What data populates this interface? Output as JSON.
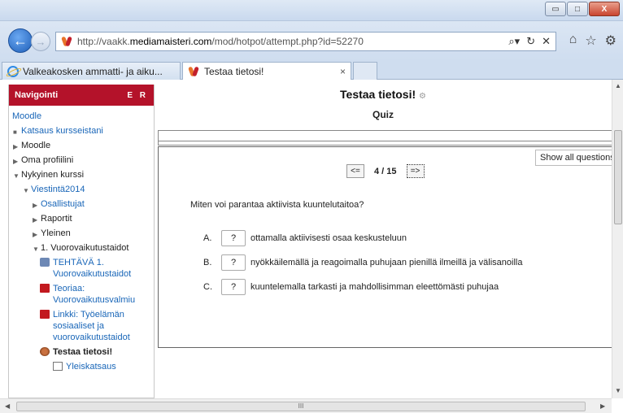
{
  "browser": {
    "url_prefix": "http://vaakk.",
    "url_domain": "mediamaisteri.com",
    "url_path": "/mod/hotpot/attempt.php?id=52270",
    "tabs": [
      {
        "label": "Valkeakosken ammatti- ja aiku..."
      },
      {
        "label": "Testaa tietosi!",
        "close": "×"
      }
    ],
    "window_controls": {
      "minimize": "▭",
      "maximize": "□",
      "close": "X"
    }
  },
  "sidebar": {
    "header": "Navigointi",
    "header_controls": "E R",
    "items": [
      {
        "label": "Moodle"
      },
      {
        "label": "Katsaus kursseistani"
      },
      {
        "label": "Moodle"
      },
      {
        "label": "Oma profiilini"
      },
      {
        "label": "Nykyinen kurssi"
      },
      {
        "label": "Viestintä2014"
      },
      {
        "label": "Osallistujat"
      },
      {
        "label": "Raportit"
      },
      {
        "label": "Yleinen"
      },
      {
        "label": "1. Vuorovaikutustaidot"
      },
      {
        "label": "TEHTÄVÄ 1. Vuorovaikutustaidot"
      },
      {
        "label": "Teoriaa: Vuorovaikutusvalmiu"
      },
      {
        "label": "Linkki: Työelämän sosiaaliset ja vuorovaikutustaidot"
      },
      {
        "label": "Testaa tietosi!"
      },
      {
        "label": "Yleiskatsaus"
      }
    ]
  },
  "quiz": {
    "title": "Testaa tietosi!",
    "subtitle": "Quiz",
    "show_all_label": "Show all questions",
    "prev_label": "<=",
    "next_label": "=>",
    "counter": "4 / 15",
    "question": "Miten voi parantaa aktiivista kuuntelutaitoa?",
    "answers": [
      {
        "letter": "A.",
        "button": "?",
        "text": "ottamalla aktiivisesti osaa keskusteluun"
      },
      {
        "letter": "B.",
        "button": "?",
        "text": "nyökkäilemällä ja reagoimalla puhujaan pienillä ilmeillä ja välisanoilla"
      },
      {
        "letter": "C.",
        "button": "?",
        "text": "kuuntelemalla tarkasti ja mahdollisimman eleettömästi puhujaa"
      }
    ]
  },
  "scrollbar": {
    "grip": "III"
  }
}
